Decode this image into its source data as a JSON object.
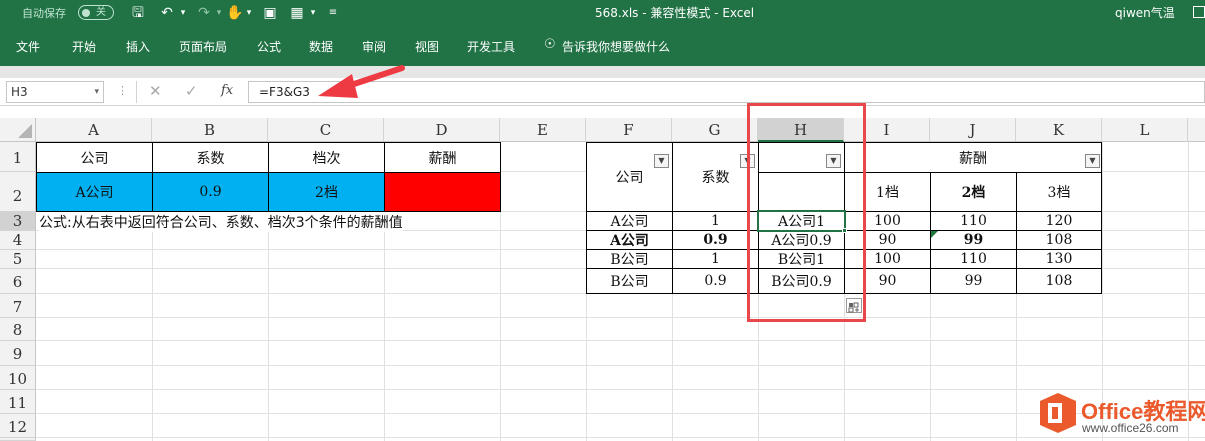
{
  "titlebar": {
    "autosave_label": "自动保存",
    "autosave_state": "关",
    "title": "568.xls  -  兼容性模式  -  Excel",
    "user": "qiwen气温"
  },
  "ribbon": {
    "tabs": [
      "文件",
      "开始",
      "插入",
      "页面布局",
      "公式",
      "数据",
      "审阅",
      "视图",
      "开发工具"
    ],
    "tell_me": "告诉我你想要做什么"
  },
  "formula_bar": {
    "name_box": "H3",
    "fx_label": "fx",
    "formula": "=F3&G3"
  },
  "columns": [
    "A",
    "B",
    "C",
    "D",
    "E",
    "F",
    "G",
    "H",
    "I",
    "J",
    "K",
    "L"
  ],
  "rows": [
    "1",
    "2",
    "3",
    "4",
    "5",
    "6",
    "7",
    "8",
    "9",
    "10",
    "11",
    "12"
  ],
  "left_table": {
    "headers": [
      "公司",
      "系数",
      "档次",
      "薪酬"
    ],
    "values": [
      "A公司",
      "0.9",
      "2档",
      ""
    ],
    "note": "公式:从右表中返回符合公司、系数、档次3个条件的薪酬值"
  },
  "right_table": {
    "header_company": "公司",
    "header_coef": "系数",
    "header_salary": "薪酬",
    "tiers": [
      "1档",
      "2档",
      "3档"
    ],
    "rows": [
      {
        "company": "A公司",
        "coef": "1",
        "key": "A公司1",
        "v1": "100",
        "v2": "110",
        "v3": "120",
        "bold": false
      },
      {
        "company": "A公司",
        "coef": "0.9",
        "key": "A公司0.9",
        "v1": "90",
        "v2": "99",
        "v3": "108",
        "bold": true
      },
      {
        "company": "B公司",
        "coef": "1",
        "key": "B公司1",
        "v1": "100",
        "v2": "110",
        "v3": "130",
        "bold": false
      },
      {
        "company": "B公司",
        "coef": "0.9",
        "key": "B公司0.9",
        "v1": "90",
        "v2": "99",
        "v3": "108",
        "bold": false
      }
    ]
  },
  "watermark": {
    "brand": "Office教程网",
    "url": "www.office26.com"
  },
  "colors": {
    "excel_green": "#217346",
    "cyan_fill": "#00b0f0",
    "red_fill": "#ff0000",
    "highlight_border": "#e8474b",
    "arrow": "#ee3a43"
  }
}
